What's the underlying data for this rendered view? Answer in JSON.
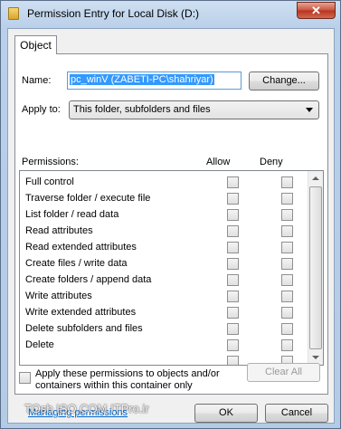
{
  "window": {
    "title": "Permission Entry for Local Disk (D:)",
    "close_label": "✕"
  },
  "tab": {
    "label": "Object"
  },
  "name": {
    "label": "Name:",
    "value": "pc_winV (ZABETI-PC\\shahriyar)",
    "change_button": "Change..."
  },
  "apply_to": {
    "label": "Apply to:",
    "value": "This folder, subfolders and files"
  },
  "permissions": {
    "header": "Permissions:",
    "allow_header": "Allow",
    "deny_header": "Deny",
    "items": [
      {
        "label": "Full control"
      },
      {
        "label": "Traverse folder / execute file"
      },
      {
        "label": "List folder / read data"
      },
      {
        "label": "Read attributes"
      },
      {
        "label": "Read extended attributes"
      },
      {
        "label": "Create files / write data"
      },
      {
        "label": "Create folders / append data"
      },
      {
        "label": "Write attributes"
      },
      {
        "label": "Write extended attributes"
      },
      {
        "label": "Delete subfolders and files"
      },
      {
        "label": "Delete"
      }
    ]
  },
  "apply_checkbox": {
    "line1": "Apply these permissions to objects and/or",
    "line2": "containers within this container only"
  },
  "clear_all_button": "Clear All",
  "managing_link": "Managing permissions",
  "ok_button": "OK",
  "cancel_button": "Cancel",
  "watermark": "TOsh ISO.COM  ITPro.ir"
}
